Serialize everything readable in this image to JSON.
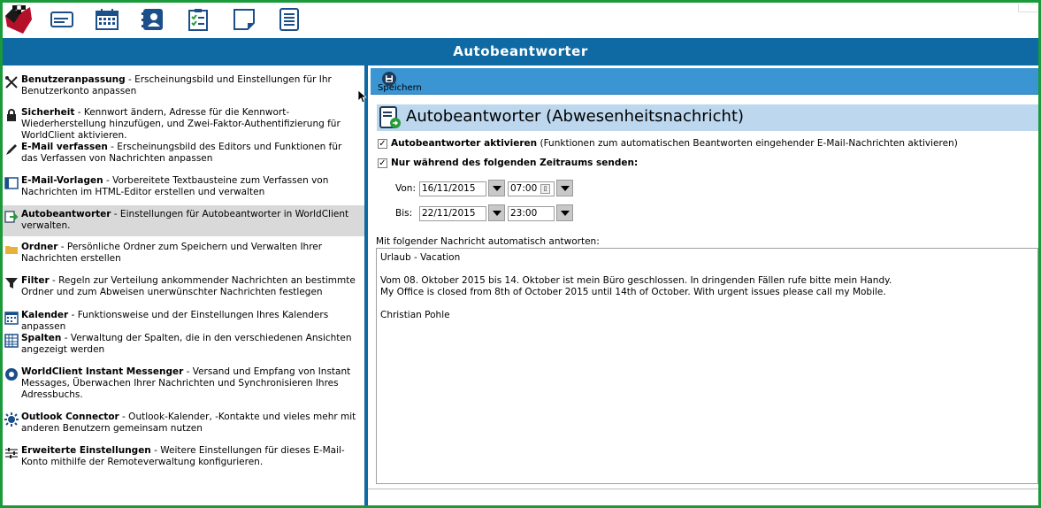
{
  "app": {
    "title": "Autobeantworter"
  },
  "toolbar": {
    "buttons": [
      {
        "icon": "mail-icon"
      },
      {
        "icon": "calendar-icon"
      },
      {
        "icon": "contacts-icon"
      },
      {
        "icon": "tasks-icon"
      },
      {
        "icon": "notes-icon"
      },
      {
        "icon": "documents-icon"
      }
    ]
  },
  "sidebar": {
    "items": [
      {
        "name": "Benutzeranpassung",
        "desc": " - Erscheinungsbild und Einstellungen für Ihr Benutzerkonto anpassen",
        "icon": "tools-icon"
      },
      {
        "name": "Sicherheit",
        "desc": " - Kennwort ändern, Adresse für die Kennwort-Wiederherstellung hinzufügen, und Zwei-Faktor-Authentifizierung für WorldClient aktivieren.",
        "icon": "lock-icon"
      },
      {
        "name": "E-Mail verfassen",
        "desc": " - Erscheinungsbild des Editors und Funktionen für das Verfassen von Nachrichten anpassen",
        "icon": "pencil-icon"
      },
      {
        "name": "E-Mail-Vorlagen",
        "desc": " - Vorbereitete Textbausteine zum Verfassen von Nachrichten im HTML-Editor erstellen und verwalten",
        "icon": "template-icon"
      },
      {
        "name": "Autobeantworter",
        "desc": " - Einstellungen für Autobeantworter in WorldClient verwalten.",
        "icon": "autoresponder-icon",
        "active": true
      },
      {
        "name": "Ordner",
        "desc": " - Persönliche Ordner zum Speichern und Verwalten Ihrer Nachrichten erstellen",
        "icon": "folder-icon"
      },
      {
        "name": "Filter",
        "desc": " - Regeln zur Verteilung ankommender Nachrichten an bestimmte Ordner und zum Abweisen unerwünschter Nachrichten festlegen",
        "icon": "filter-icon"
      },
      {
        "name": "Kalender",
        "desc": " - Funktionsweise und der Einstellungen Ihres Kalenders anpassen",
        "icon": "calendar-icon"
      },
      {
        "name": "Spalten",
        "desc": " - Verwaltung der Spalten, die in den verschiedenen Ansichten angezeigt werden",
        "icon": "columns-icon"
      },
      {
        "name": "WorldClient Instant Messenger",
        "desc": " - Versand und Empfang von Instant Messages, Überwachen Ihrer Nachrichten und Synchronisieren Ihres Adressbuchs.",
        "icon": "messenger-icon"
      },
      {
        "name": "Outlook Connector",
        "desc": " - Outlook-Kalender, -Kontakte und vieles mehr mit anderen Benutzern gemeinsam nutzen",
        "icon": "outlook-connector-icon"
      },
      {
        "name": "Erweiterte Einstellungen",
        "desc": " - Weitere Einstellungen für dieses E-Mail-Konto mithilfe der Remoteverwaltung konfigurieren.",
        "icon": "advanced-settings-icon"
      }
    ]
  },
  "actions": {
    "save_label": "Speichern"
  },
  "form": {
    "section_title": "Autobeantworter (Abwesenheitsnachricht)",
    "enable_label": "Autobeantworter aktivieren",
    "enable_desc": " (Funktionen zum automatischen Beantworten eingehender E-Mail-Nachrichten aktivieren)",
    "enable_checked": true,
    "period_label": "Nur während des folgenden Zeitraums senden:",
    "period_checked": true,
    "from_label": "Von:",
    "from_date": "16/11/2015",
    "from_time": "07:00",
    "to_label": "Bis:",
    "to_date": "22/11/2015",
    "to_time": "23:00",
    "message_label": "Mit folgender Nachricht automatisch antworten:",
    "message_lines": [
      "Urlaub - Vacation",
      "",
      "Vom 08. Oktober 2015 bis 14. Oktober ist mein Büro geschlossen.  In dringenden Fällen rufe bitte mein Handy.",
      "My Office is closed from 8th of October 2015 until 14th of October. With urgent issues please call my Mobile.",
      "",
      "Christian Pohle"
    ]
  },
  "colors": {
    "accent": "#0f6aa3",
    "action_bar": "#3a95d2",
    "section_bg": "#bcd7ee",
    "frame": "#1a9a3a"
  }
}
